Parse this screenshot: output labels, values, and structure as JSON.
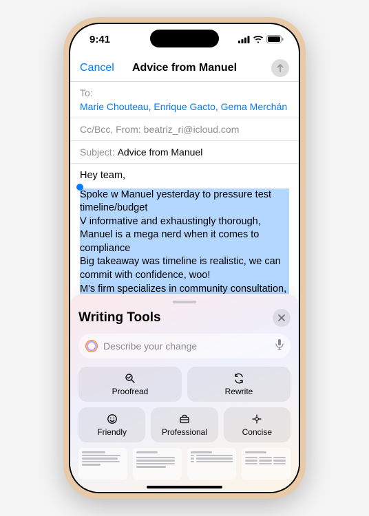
{
  "status": {
    "time": "9:41"
  },
  "nav": {
    "cancel": "Cancel",
    "title": "Advice from Manuel"
  },
  "fields": {
    "to_label": "To:",
    "to_names": "Marie Chouteau, Enrique Gacto, Gema Merchán",
    "ccbcc_label": "Cc/Bcc, From:",
    "from_email": "beatriz_ri@icloud.com",
    "subject_label": "Subject:",
    "subject_value": "Advice from Manuel"
  },
  "body": {
    "greeting": "Hey team,",
    "selected": [
      "Spoke w Manuel yesterday to pressure test timeline/budget",
      "V informative and exhaustingly thorough, Manuel is a mega nerd when it comes to compliance",
      "Big takeaway was timeline is realistic, we can commit with confidence, woo!",
      "M's firm specializes in community consultation, we need help here, should consider engaging"
    ]
  },
  "sheet": {
    "title": "Writing Tools",
    "placeholder": "Describe your change",
    "buttons": {
      "proofread": "Proofread",
      "rewrite": "Rewrite",
      "friendly": "Friendly",
      "professional": "Professional",
      "concise": "Concise"
    }
  }
}
